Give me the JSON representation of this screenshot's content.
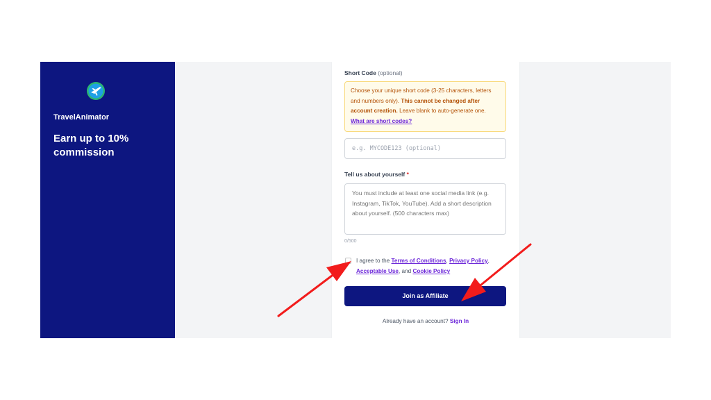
{
  "brand": {
    "name": "TravelAnimator",
    "headline": "Earn up to 10% commission",
    "logo_icon": "airplane-globe-icon",
    "panel_color": "#0d1680"
  },
  "form": {
    "short_code": {
      "label": "Short Code",
      "optional_suffix": "(optional)",
      "info_text_1": "Choose your unique short code (3-25 characters, letters and numbers only). ",
      "info_text_bold": "This cannot be changed after account creation.",
      "info_text_2": " Leave blank to auto-generate one. ",
      "info_link": "What are short codes?",
      "placeholder": "e.g. MYCODE123 (optional)"
    },
    "about": {
      "label": "Tell us about yourself",
      "required_marker": "*",
      "placeholder": "You must include at least one social media link (e.g. Instagram, TikTok, YouTube). Add a short description about yourself. (500 characters max)",
      "char_count": "0/500"
    },
    "agreement": {
      "prefix": "I agree to the ",
      "terms": "Terms of Conditions",
      "sep1": ", ",
      "privacy": "Privacy Policy",
      "sep2": ",",
      "acceptable_use": "Acceptable Use",
      "sep3": ", and ",
      "cookie": "Cookie Policy",
      "checked": false
    },
    "submit_label": "Join as Affiliate",
    "signin_prompt": "Already have an account?",
    "signin_link": "Sign In"
  },
  "colors": {
    "accent": "#0d1680",
    "link": "#6d28d9",
    "annotation_arrow": "#f21c1c"
  }
}
